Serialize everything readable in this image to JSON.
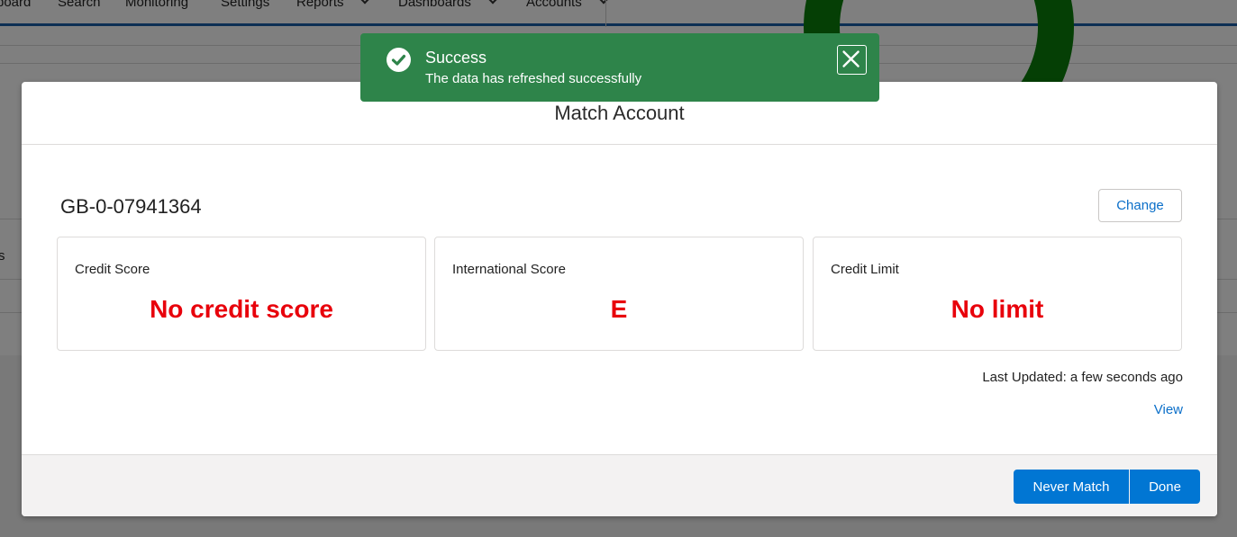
{
  "background": {
    "nav": [
      "board",
      "Search",
      "Monitoring",
      "Settings",
      "Reports",
      "Dashboards",
      "Accounts"
    ],
    "left_fragment": "s"
  },
  "toast": {
    "title": "Success",
    "message": "The data has refreshed successfully",
    "icon": "success-check-icon",
    "color": "#2e844a"
  },
  "modal": {
    "title": "Match Account",
    "account_id": "GB-0-07941364",
    "change_label": "Change",
    "cards": [
      {
        "label": "Credit Score",
        "value": "No credit score"
      },
      {
        "label": "International Score",
        "value": "E"
      },
      {
        "label": "Credit Limit",
        "value": "No limit"
      }
    ],
    "last_updated": "Last Updated: a few seconds ago",
    "view_label": "View",
    "footer": {
      "never_match_label": "Never Match",
      "done_label": "Done"
    },
    "accent_color": "#0176d3",
    "value_color": "#e8000b"
  }
}
